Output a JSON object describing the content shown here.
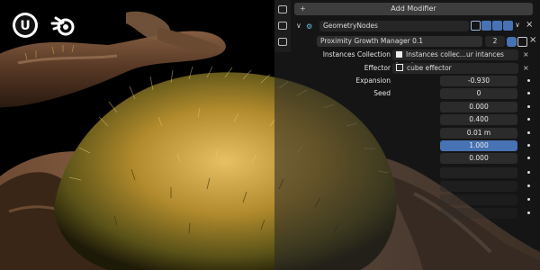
{
  "app": {
    "add_modifier_label": "Add Modifier",
    "modifier": {
      "name": "GeometryNodes",
      "node_group": "Proximity Growth Manager 0.1",
      "user_count": "2"
    },
    "inputs": [
      {
        "label": "Instances Collection",
        "value": "Instances collec...ur intances here)",
        "kind": "object",
        "icon": "collection-icon"
      },
      {
        "label": "Effector",
        "value": "cube effector",
        "kind": "object",
        "icon": "object-icon"
      },
      {
        "label": "Expansion",
        "value": "-0.930",
        "kind": "number"
      },
      {
        "label": "Seed",
        "value": "0",
        "kind": "number"
      },
      {
        "label": "",
        "value": "0.000",
        "kind": "number"
      },
      {
        "label": "",
        "value": "0.400",
        "kind": "number"
      },
      {
        "label": "",
        "value": "0.01 m",
        "kind": "number"
      },
      {
        "label": "",
        "value": "1.000",
        "kind": "number",
        "active": true
      },
      {
        "label": "",
        "value": "0.000",
        "kind": "number"
      }
    ]
  },
  "colors": {
    "accent": "#4772b3",
    "field_bg": "#2b2b2b",
    "panel_bg": "#303030"
  }
}
